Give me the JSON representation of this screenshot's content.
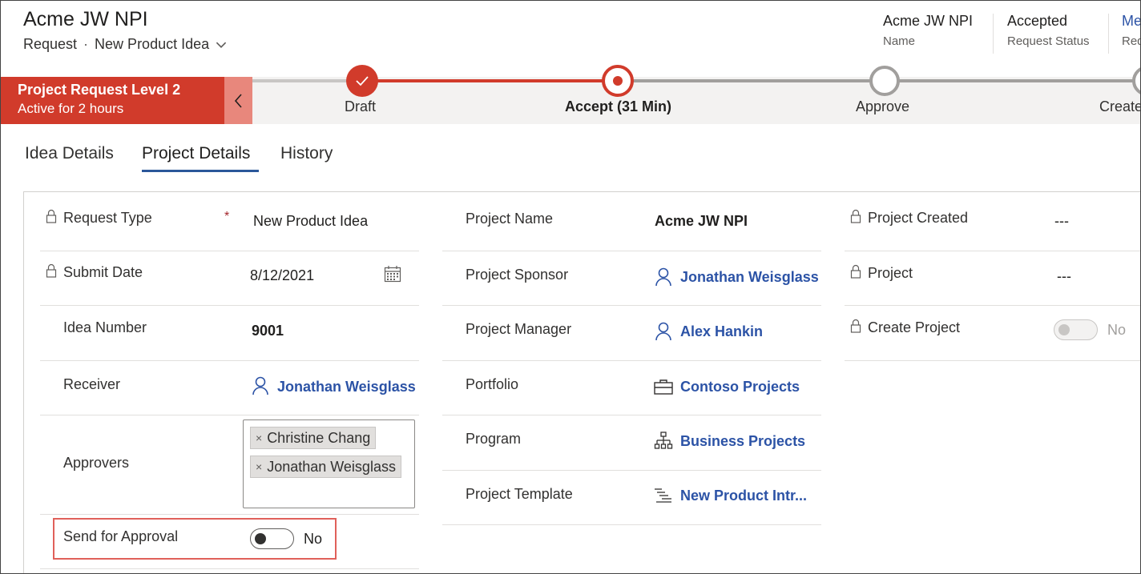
{
  "header": {
    "title": "Acme JW NPI",
    "entity": "Request",
    "separator": "·",
    "form_name": "New Product Idea",
    "fields": [
      {
        "value": "Acme JW NPI",
        "label": "Name"
      },
      {
        "value": "Accepted",
        "label": "Request Status"
      },
      {
        "value": "Me",
        "label": "Req"
      }
    ]
  },
  "bpf": {
    "active_stage_name": "Project Request Level 2",
    "active_stage_duration": "Active for 2 hours",
    "stages": [
      {
        "label": "Draft",
        "state": "completed"
      },
      {
        "label": "Accept  (31 Min)",
        "state": "active"
      },
      {
        "label": "Approve",
        "state": "pending"
      },
      {
        "label": "Create",
        "state": "pending"
      }
    ],
    "colors": {
      "active": "#d13b2b",
      "pending": "#a19f9d",
      "collapse": "#e8877c"
    }
  },
  "tabs": [
    {
      "label": "Idea Details",
      "selected": false
    },
    {
      "label": "Project Details",
      "selected": true
    },
    {
      "label": "History",
      "selected": false
    }
  ],
  "form": {
    "left": {
      "request_type": {
        "label": "Request Type",
        "required_mark": "*",
        "value": "New Product Idea"
      },
      "submit_date": {
        "label": "Submit Date",
        "value": "8/12/2021"
      },
      "idea_number": {
        "label": "Idea Number",
        "value": "9001"
      },
      "receiver": {
        "label": "Receiver",
        "value": "Jonathan Weisglass"
      },
      "approvers": {
        "label": "Approvers",
        "values": [
          "Christine Chang",
          "Jonathan Weisglass"
        ],
        "remove_glyph": "×"
      },
      "send_for_approval": {
        "label": "Send for Approval",
        "value": "No"
      }
    },
    "middle": {
      "project_name": {
        "label": "Project Name",
        "value": "Acme JW NPI"
      },
      "project_sponsor": {
        "label": "Project Sponsor",
        "value": "Jonathan Weisglass"
      },
      "project_manager": {
        "label": "Project Manager",
        "value": "Alex Hankin"
      },
      "portfolio": {
        "label": "Portfolio",
        "value": "Contoso Projects"
      },
      "program": {
        "label": "Program",
        "value": "Business Projects"
      },
      "project_template": {
        "label": "Project Template",
        "value": "New Product Intr..."
      }
    },
    "right": {
      "project_created": {
        "label": "Project Created",
        "value": "---"
      },
      "project": {
        "label": "Project",
        "value": "---"
      },
      "create_project": {
        "label": "Create Project",
        "value": "No"
      }
    }
  },
  "colors": {
    "link": "#2c53a6",
    "accent_tab": "#2b579a",
    "highlight": "#e0605a"
  }
}
